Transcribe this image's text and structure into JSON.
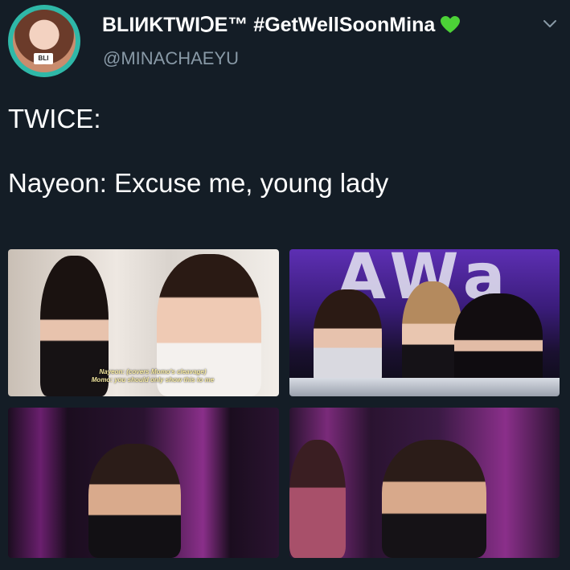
{
  "tweet": {
    "display_name": "BLIИKTWIↃE™ #GetWellSoonMina",
    "handle": "@MINACHAEYU",
    "avatar_badge": "BLI",
    "text_lines": [
      "TWICE:",
      "",
      "Nayeon: Excuse me, young lady"
    ]
  },
  "media": {
    "images": [
      {
        "name": "Nayeon covering Momo",
        "subtitles": [
          "Nayeon: (covers Momo's cleavage)",
          "Momo: you should only show this to me"
        ]
      },
      {
        "name": "Stage banner",
        "banner_text": "AWa"
      },
      {
        "name": "Chaeyoung on stage"
      },
      {
        "name": "Chaeyoung covered by member"
      }
    ]
  },
  "colors": {
    "background": "#141d26",
    "text": "#ffffff",
    "secondary_text": "#8899a6",
    "heart": "#4cd137",
    "avatar_ring": "#2fb8a8"
  },
  "icons": {
    "heart": "green-heart-icon",
    "menu": "chevron-down-icon"
  }
}
